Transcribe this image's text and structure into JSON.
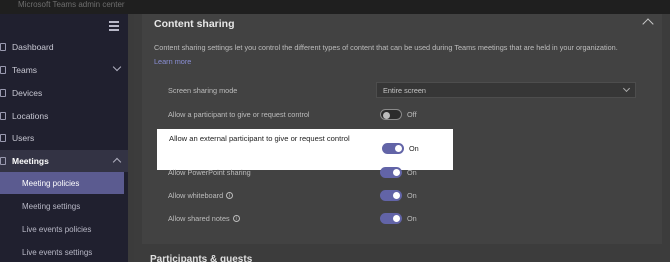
{
  "app": {
    "title": "Microsoft Teams admin center"
  },
  "sidebar": {
    "items": [
      {
        "label": "Dashboard"
      },
      {
        "label": "Teams"
      },
      {
        "label": "Devices"
      },
      {
        "label": "Locations"
      },
      {
        "label": "Users"
      },
      {
        "label": "Meetings"
      }
    ],
    "subitems": [
      {
        "label": "Meeting policies"
      },
      {
        "label": "Meeting settings"
      },
      {
        "label": "Live events policies"
      },
      {
        "label": "Live events settings"
      }
    ]
  },
  "content_sharing": {
    "title": "Content sharing",
    "description": "Content sharing settings let you control the different types of content that can be used during Teams meetings that are held in your organization.",
    "learn_more": "Learn more",
    "screen_sharing": {
      "label": "Screen sharing mode",
      "value": "Entire screen"
    },
    "give_control": {
      "label": "Allow a participant to give or request control",
      "state": "Off"
    },
    "external_control": {
      "label": "Allow an external participant to give or request control",
      "state": "On"
    },
    "powerpoint": {
      "label": "Allow PowerPoint sharing",
      "state": "On"
    },
    "whiteboard": {
      "label": "Allow whiteboard",
      "state": "On"
    },
    "shared_notes": {
      "label": "Allow shared notes",
      "state": "On"
    }
  },
  "participants": {
    "title": "Participants & guests"
  }
}
